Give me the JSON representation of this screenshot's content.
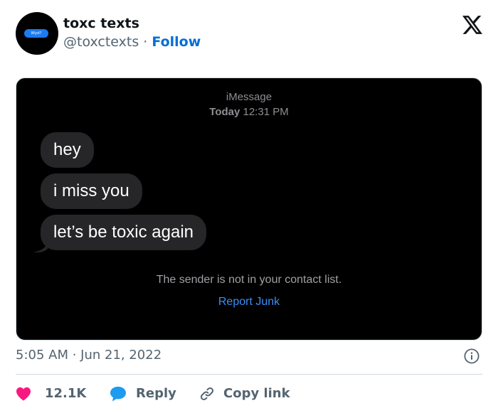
{
  "author": {
    "display_name": "toxc texts",
    "handle": "@toxctexts",
    "separator": " · ",
    "follow_label": "Follow",
    "avatar_text": "Wyd?"
  },
  "platform_icon": "x-logo-icon",
  "media": {
    "service": "iMessage",
    "day": "Today",
    "time": "12:31 PM",
    "messages": [
      "hey",
      "i miss you",
      "let’s be toxic again"
    ],
    "notice": "The sender is not in your contact list.",
    "report_label": "Report Junk"
  },
  "footer": {
    "timestamp": "5:05 AM · Jun 21, 2022",
    "info_icon": "info-icon"
  },
  "actions": {
    "like_count": "12.1K",
    "reply_label": "Reply",
    "copy_label": "Copy link"
  },
  "colors": {
    "accent": "#006fd6",
    "like": "#f91880",
    "reply": "#1d9bf0",
    "report_link": "#3e8df6",
    "bubble": "#262628"
  }
}
